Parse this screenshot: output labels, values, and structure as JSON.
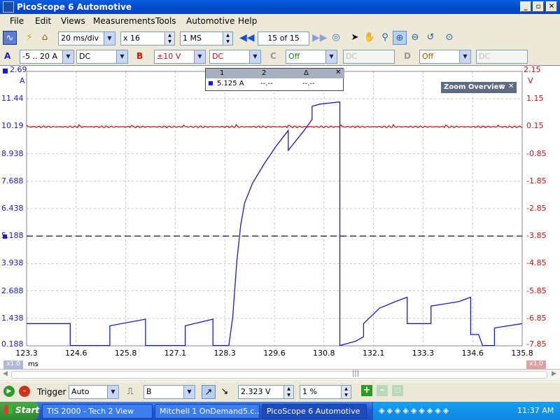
{
  "window": {
    "title": "PicoScope 6 Automotive",
    "controls": [
      "_",
      "▫",
      "✕"
    ]
  },
  "menu": [
    "File",
    "Edit",
    "Views",
    "Measurements",
    "Tools",
    "Automotive",
    "Help"
  ],
  "toolbar": {
    "timebase": "20 ms/div",
    "zoom_factor": "x 16",
    "samples": "1 MS",
    "buffer_current": "15",
    "buffer_of": "of 15"
  },
  "channels": {
    "a": {
      "label": "A",
      "range": "-5 .. 20 A",
      "coupling": "DC",
      "color": "#1a1ad0"
    },
    "b": {
      "label": "B",
      "range": "±10 V",
      "coupling": "DC",
      "color": "#d01010"
    },
    "c": {
      "label": "C",
      "range": "Off",
      "coupling": "DC"
    },
    "d": {
      "label": "D",
      "range": "Off",
      "coupling": "DC"
    }
  },
  "left_axis": {
    "unit": "A",
    "ticks": [
      "2.69",
      "11.44",
      "10.19",
      "8.938",
      "7.688",
      "6.438",
      "5.188",
      "3.938",
      "2.688",
      "1.438",
      "0.188"
    ]
  },
  "right_axis": {
    "unit": "V",
    "ticks": [
      "2.15",
      "1.15",
      "0.15",
      "-0.85",
      "-1.85",
      "-2.85",
      "-3.85",
      "-4.85",
      "-5.85",
      "-6.85",
      "-7.85"
    ]
  },
  "x_axis": {
    "ticks": [
      "123.3",
      "124.6",
      "125.8",
      "127.1",
      "128.3",
      "129.6",
      "130.8",
      "132.1",
      "133.3",
      "134.6",
      "135.8"
    ],
    "unit": "ms",
    "zoom_left": "x1.0",
    "zoom_right": "x1.0"
  },
  "ruler": {
    "headers": [
      "1",
      "2",
      "Δ"
    ],
    "values": [
      "5.125 A",
      "--.--",
      "--.--"
    ]
  },
  "zoom_overview": {
    "title": "Zoom Overview"
  },
  "trigger": {
    "label": "Trigger",
    "mode": "Auto",
    "source": "B",
    "level": "2.323 V",
    "pretrigger": "1 %"
  },
  "taskbar": {
    "start": "Start",
    "tasks": [
      "TIS 2000 - Tech 2 View",
      "Mitchell 1 OnDemand5.c...",
      "PicoScope 6 Automotive"
    ],
    "clock": "11:37 AM"
  },
  "chart_data": {
    "type": "line",
    "x_unit": "ms",
    "xlim": [
      123.3,
      135.8
    ],
    "series": [
      {
        "axis": "left",
        "unit": "A",
        "color": "#1a1ad0",
        "points": [
          [
            123.3,
            1.2
          ],
          [
            124.4,
            1.2
          ],
          [
            124.4,
            0.2
          ],
          [
            125.4,
            0.2
          ],
          [
            125.4,
            1.1
          ],
          [
            126.3,
            1.4
          ],
          [
            126.3,
            0.2
          ],
          [
            127.3,
            0.2
          ],
          [
            127.3,
            1.1
          ],
          [
            128.0,
            1.4
          ],
          [
            128.0,
            0.2
          ],
          [
            128.4,
            0.2
          ],
          [
            128.5,
            1.5
          ],
          [
            128.6,
            4.0
          ],
          [
            128.7,
            5.7
          ],
          [
            128.8,
            6.7
          ],
          [
            129.0,
            7.6
          ],
          [
            129.3,
            8.5
          ],
          [
            129.6,
            9.3
          ],
          [
            129.9,
            10.0
          ],
          [
            129.9,
            9.1
          ],
          [
            130.3,
            10.0
          ],
          [
            130.5,
            10.5
          ],
          [
            130.5,
            11.1
          ],
          [
            130.7,
            11.2
          ],
          [
            131.2,
            11.3
          ],
          [
            131.2,
            0.2
          ],
          [
            131.6,
            0.4
          ],
          [
            131.8,
            0.6
          ],
          [
            131.8,
            1.2
          ],
          [
            132.2,
            1.9
          ],
          [
            132.6,
            2.2
          ],
          [
            132.9,
            2.4
          ],
          [
            132.9,
            1.2
          ],
          [
            133.5,
            1.2
          ],
          [
            133.5,
            2.0
          ],
          [
            134.2,
            2.2
          ],
          [
            134.5,
            2.4
          ],
          [
            134.5,
            0.7
          ],
          [
            134.7,
            0.7
          ],
          [
            134.8,
            0.2
          ],
          [
            135.1,
            0.2
          ],
          [
            135.1,
            1.0
          ],
          [
            135.8,
            1.2
          ]
        ]
      },
      {
        "axis": "right",
        "unit": "V",
        "color": "#d01010",
        "points": [
          [
            123.3,
            0.15
          ],
          [
            125.0,
            0.12
          ],
          [
            127.0,
            0.15
          ],
          [
            129.0,
            0.1
          ],
          [
            131.0,
            0.15
          ],
          [
            133.0,
            0.1
          ],
          [
            135.8,
            0.12
          ]
        ]
      }
    ],
    "trigger_level_v": -3.85,
    "grid": true,
    "legend": "none"
  }
}
